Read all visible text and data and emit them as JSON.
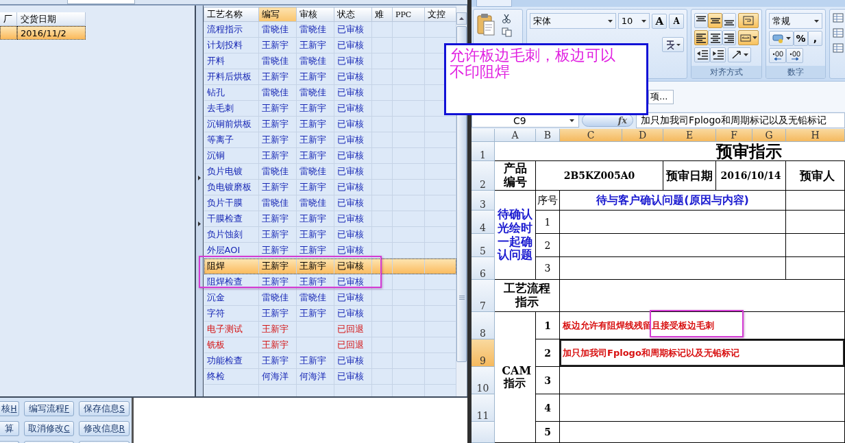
{
  "order_list": {
    "columns": [
      "厂",
      "交货日期"
    ],
    "rows": [
      {
        "delivery_date": "2016/11/2",
        "selected": true
      }
    ]
  },
  "process_table": {
    "columns": [
      {
        "label": "工艺名称",
        "selected": false
      },
      {
        "label": "编写",
        "selected": true
      },
      {
        "label": "审核",
        "selected": false
      },
      {
        "label": "状态",
        "selected": false
      },
      {
        "label": "难",
        "selected": false
      },
      {
        "label": "PPC",
        "selected": false
      },
      {
        "label": "文控",
        "selected": false
      }
    ],
    "rows": [
      {
        "name": "流程指示",
        "writer": "雷晓佳",
        "reviewer": "雷晓佳",
        "status": "已审核",
        "returned": false,
        "selected": false
      },
      {
        "name": "计划投料",
        "writer": "王新宇",
        "reviewer": "王新宇",
        "status": "已审核",
        "returned": false,
        "selected": false
      },
      {
        "name": "开料",
        "writer": "雷晓佳",
        "reviewer": "雷晓佳",
        "status": "已审核",
        "returned": false,
        "selected": false
      },
      {
        "name": "开料后烘板",
        "writer": "王新宇",
        "reviewer": "王新宇",
        "status": "已审核",
        "returned": false,
        "selected": false
      },
      {
        "name": "钻孔",
        "writer": "雷晓佳",
        "reviewer": "雷晓佳",
        "status": "已审核",
        "returned": false,
        "selected": false
      },
      {
        "name": "去毛刺",
        "writer": "王新宇",
        "reviewer": "王新宇",
        "status": "已审核",
        "returned": false,
        "selected": false
      },
      {
        "name": "沉铜前烘板",
        "writer": "王新宇",
        "reviewer": "王新宇",
        "status": "已审核",
        "returned": false,
        "selected": false
      },
      {
        "name": "等离子",
        "writer": "王新宇",
        "reviewer": "王新宇",
        "status": "已审核",
        "returned": false,
        "selected": false
      },
      {
        "name": "沉铜",
        "writer": "王新宇",
        "reviewer": "王新宇",
        "status": "已审核",
        "returned": false,
        "selected": false
      },
      {
        "name": "负片电镀",
        "writer": "雷晓佳",
        "reviewer": "雷晓佳",
        "status": "已审核",
        "returned": false,
        "selected": false
      },
      {
        "name": "负电镀磨板",
        "writer": "王新宇",
        "reviewer": "王新宇",
        "status": "已审核",
        "returned": false,
        "selected": false
      },
      {
        "name": "负片干膜",
        "writer": "雷晓佳",
        "reviewer": "雷晓佳",
        "status": "已审核",
        "returned": false,
        "selected": false
      },
      {
        "name": "干膜检查",
        "writer": "王新宇",
        "reviewer": "王新宇",
        "status": "已审核",
        "returned": false,
        "selected": false
      },
      {
        "name": "负片蚀刻",
        "writer": "王新宇",
        "reviewer": "王新宇",
        "status": "已审核",
        "returned": false,
        "selected": false
      },
      {
        "name": "外层AOI",
        "writer": "王新宇",
        "reviewer": "王新宇",
        "status": "已审核",
        "returned": false,
        "selected": false
      },
      {
        "name": "阻焊",
        "writer": "王新宇",
        "reviewer": "王新宇",
        "status": "已审核",
        "returned": false,
        "selected": true
      },
      {
        "name": "阻焊检查",
        "writer": "王新宇",
        "reviewer": "王新宇",
        "status": "已审核",
        "returned": false,
        "selected": false
      },
      {
        "name": "沉金",
        "writer": "雷晓佳",
        "reviewer": "雷晓佳",
        "status": "已审核",
        "returned": false,
        "selected": false
      },
      {
        "name": "字符",
        "writer": "王新宇",
        "reviewer": "王新宇",
        "status": "已审核",
        "returned": false,
        "selected": false
      },
      {
        "name": "电子测试",
        "writer": "王新宇",
        "status": "已回退",
        "returned": true,
        "selected": false
      },
      {
        "name": "铣板",
        "writer": "王新宇",
        "status": "已回退",
        "returned": true,
        "selected": false
      },
      {
        "name": "功能检查",
        "writer": "王新宇",
        "reviewer": "王新宇",
        "status": "已审核",
        "returned": false,
        "selected": false
      },
      {
        "name": "终检",
        "writer": "何海洋",
        "reviewer": "何海洋",
        "status": "已审核",
        "returned": false,
        "selected": false
      }
    ]
  },
  "buttons": [
    [
      {
        "label": "核",
        "hotkey": "H"
      },
      {
        "label": "编写流程",
        "hotkey": "F"
      },
      {
        "label": "保存信息",
        "hotkey": "S"
      }
    ],
    [
      {
        "label": "算"
      },
      {
        "label": "取消修改",
        "hotkey": "C"
      },
      {
        "label": "修改信息",
        "hotkey": "R"
      }
    ]
  ],
  "excel": {
    "font_name": "宋体",
    "font_size": "10",
    "font_buttons": [
      "A",
      "A"
    ],
    "align_buttons": [
      {
        "kind": "top",
        "selected": false
      },
      {
        "kind": "middle",
        "selected": true
      },
      {
        "kind": "bottom",
        "selected": false
      },
      {
        "kind": "wrap",
        "selected": true
      },
      {
        "kind": "left",
        "selected": true
      },
      {
        "kind": "center",
        "selected": false
      },
      {
        "kind": "right",
        "selected": false
      },
      {
        "kind": "merge",
        "selected": true
      }
    ],
    "alignment_group": "对齐方式",
    "number_format": "常规",
    "number_buttons": [
      "%",
      ","
    ],
    "number_group": "数字",
    "options_button": "项...",
    "name_box": "C9",
    "function_button": "fx",
    "formula": "加只加我司Fplogo和周期标记以及无铅标记",
    "columns": [
      {
        "label": "A",
        "selected": false
      },
      {
        "label": "B",
        "selected": false
      },
      {
        "label": "C",
        "selected": true
      },
      {
        "label": "D",
        "selected": true
      },
      {
        "label": "E",
        "selected": true
      },
      {
        "label": "F",
        "selected": true
      },
      {
        "label": "G",
        "selected": true
      },
      {
        "label": "H",
        "selected": true
      }
    ],
    "rows": [
      {
        "label": "1",
        "selected": false
      },
      {
        "label": "2",
        "selected": false
      },
      {
        "label": "3",
        "selected": false
      },
      {
        "label": "4",
        "selected": false
      },
      {
        "label": "5",
        "selected": false
      },
      {
        "label": "6",
        "selected": false
      },
      {
        "label": "7",
        "selected": false
      },
      {
        "label": "8",
        "selected": false
      },
      {
        "label": "9",
        "selected": true
      },
      {
        "label": "10",
        "selected": false
      },
      {
        "label": "11",
        "selected": false
      }
    ],
    "sheet": {
      "title": "预审指示",
      "product_label": "产品编号",
      "product_number": "2B5KZ005A0",
      "date_label": "预审日期",
      "review_date": "2016/10/14",
      "reviewer_label": "预审人",
      "confirm_label": "待确认光绘时一起确认问题",
      "number_header": "序号",
      "question_heading": "待与客户确认问题(原因与内容)",
      "question_numbers": [
        "1",
        "2",
        "3"
      ],
      "process_label": "工艺流程指示",
      "cam_label": "CAM指示",
      "cam_items": [
        {
          "number": "1",
          "text": "板边允许有阻焊线残留且接受板边毛刺",
          "selected": false
        },
        {
          "number": "2",
          "text": "加只加我司Fplogo和周期标记以及无铅标记",
          "selected": true
        },
        {
          "number": "3",
          "selected": false
        },
        {
          "number": "4",
          "selected": false
        },
        {
          "number": "5",
          "selected": false
        }
      ]
    }
  },
  "comment": {
    "text": "允许板边毛刺，板边可以不印阻焊"
  }
}
